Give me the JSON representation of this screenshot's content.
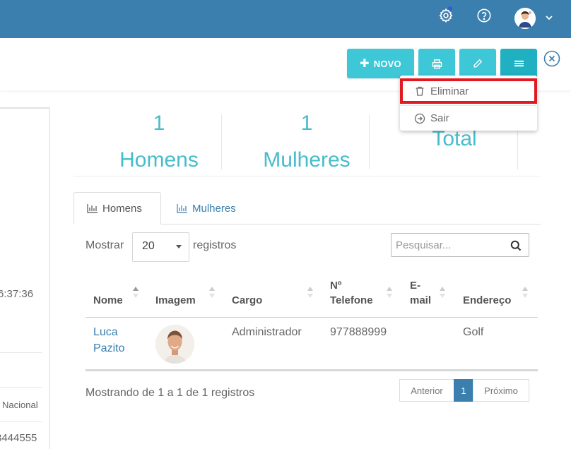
{
  "header": {
    "icons": [
      "gear-icon",
      "help-icon",
      "user-avatar",
      "chevron-down-icon"
    ]
  },
  "toolbar": {
    "novo_label": "NOVO",
    "icons": [
      "plus-icon",
      "printer-icon",
      "pencil-icon",
      "menu-icon",
      "close-circle-icon"
    ]
  },
  "dropdown": {
    "items": [
      {
        "label": "Eliminar",
        "icon": "trash-icon"
      },
      {
        "label": "Sair",
        "icon": "arrow-circle-right-icon"
      }
    ]
  },
  "left_panel": {
    "time_fragment": "6:37:36",
    "nacional_fragment": "Nacional",
    "phone_fragment": "3444555"
  },
  "stats": [
    {
      "value": "1",
      "label": "Homens"
    },
    {
      "value": "1",
      "label": "Mulheres"
    },
    {
      "value": "",
      "label": "Total"
    }
  ],
  "tabs": [
    {
      "label": "Homens",
      "icon": "bar-chart-icon",
      "active": true
    },
    {
      "label": "Mulheres",
      "icon": "bar-chart-icon",
      "active": false
    }
  ],
  "table_controls": {
    "show_label": "Mostrar",
    "page_size": "20",
    "records_label": "registros",
    "search_placeholder": "Pesquisar..."
  },
  "table": {
    "columns": [
      {
        "line1": "Nome",
        "line2": ""
      },
      {
        "line1": "Imagem",
        "line2": ""
      },
      {
        "line1": "Cargo",
        "line2": ""
      },
      {
        "line1": "Nº",
        "line2": "Telefone"
      },
      {
        "line1": "E-",
        "line2": "mail"
      },
      {
        "line1": "Endereço",
        "line2": ""
      }
    ],
    "rows": [
      {
        "nome_line1": "Luca",
        "nome_line2": "Pazito",
        "cargo": "Administrador",
        "telefone": "977888999",
        "email": "",
        "endereco": "Golf"
      }
    ]
  },
  "footer": {
    "info": "Mostrando de 1 a 1 de 1 registros",
    "prev": "Anterior",
    "page": "1",
    "next": "Próximo"
  },
  "colors": {
    "topbar": "#3a7fae",
    "button": "#3ec8d7",
    "button_active": "#1fb1c1",
    "highlight": "#e11a22",
    "stat_text": "#47bccb"
  }
}
